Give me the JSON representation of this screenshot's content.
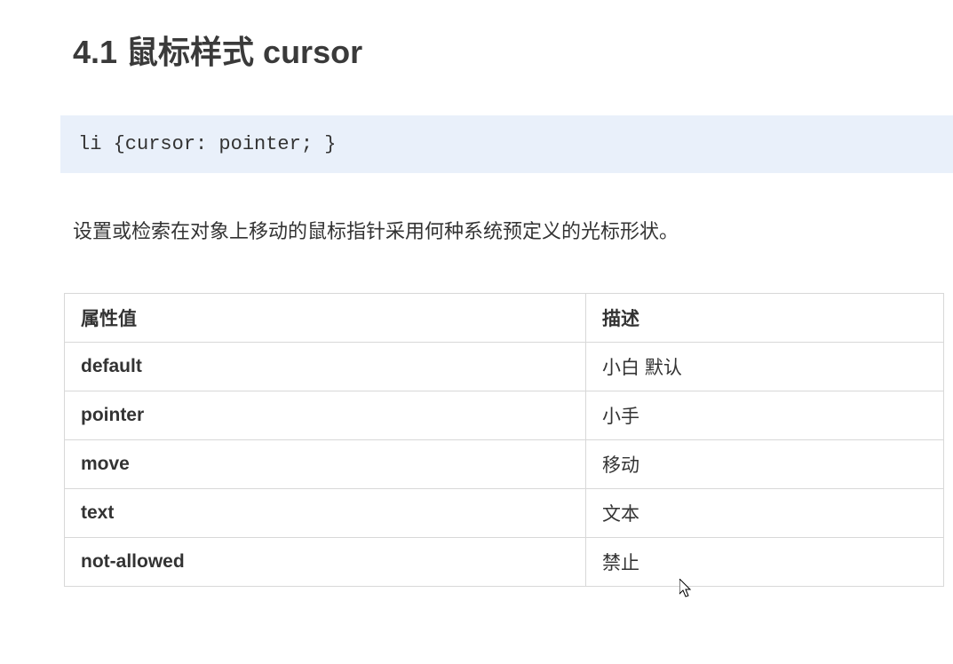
{
  "heading": "4.1 鼠标样式 cursor",
  "code": "li {cursor: pointer; }",
  "description": "设置或检索在对象上移动的鼠标指针采用何种系统预定义的光标形状。",
  "table": {
    "headers": [
      "属性值",
      "描述"
    ],
    "rows": [
      {
        "value": "default",
        "desc": "小白  默认"
      },
      {
        "value": "pointer",
        "desc": "小手"
      },
      {
        "value": "move",
        "desc": "移动"
      },
      {
        "value": "text",
        "desc": "文本"
      },
      {
        "value": "not-allowed",
        "desc": "禁止"
      }
    ]
  }
}
